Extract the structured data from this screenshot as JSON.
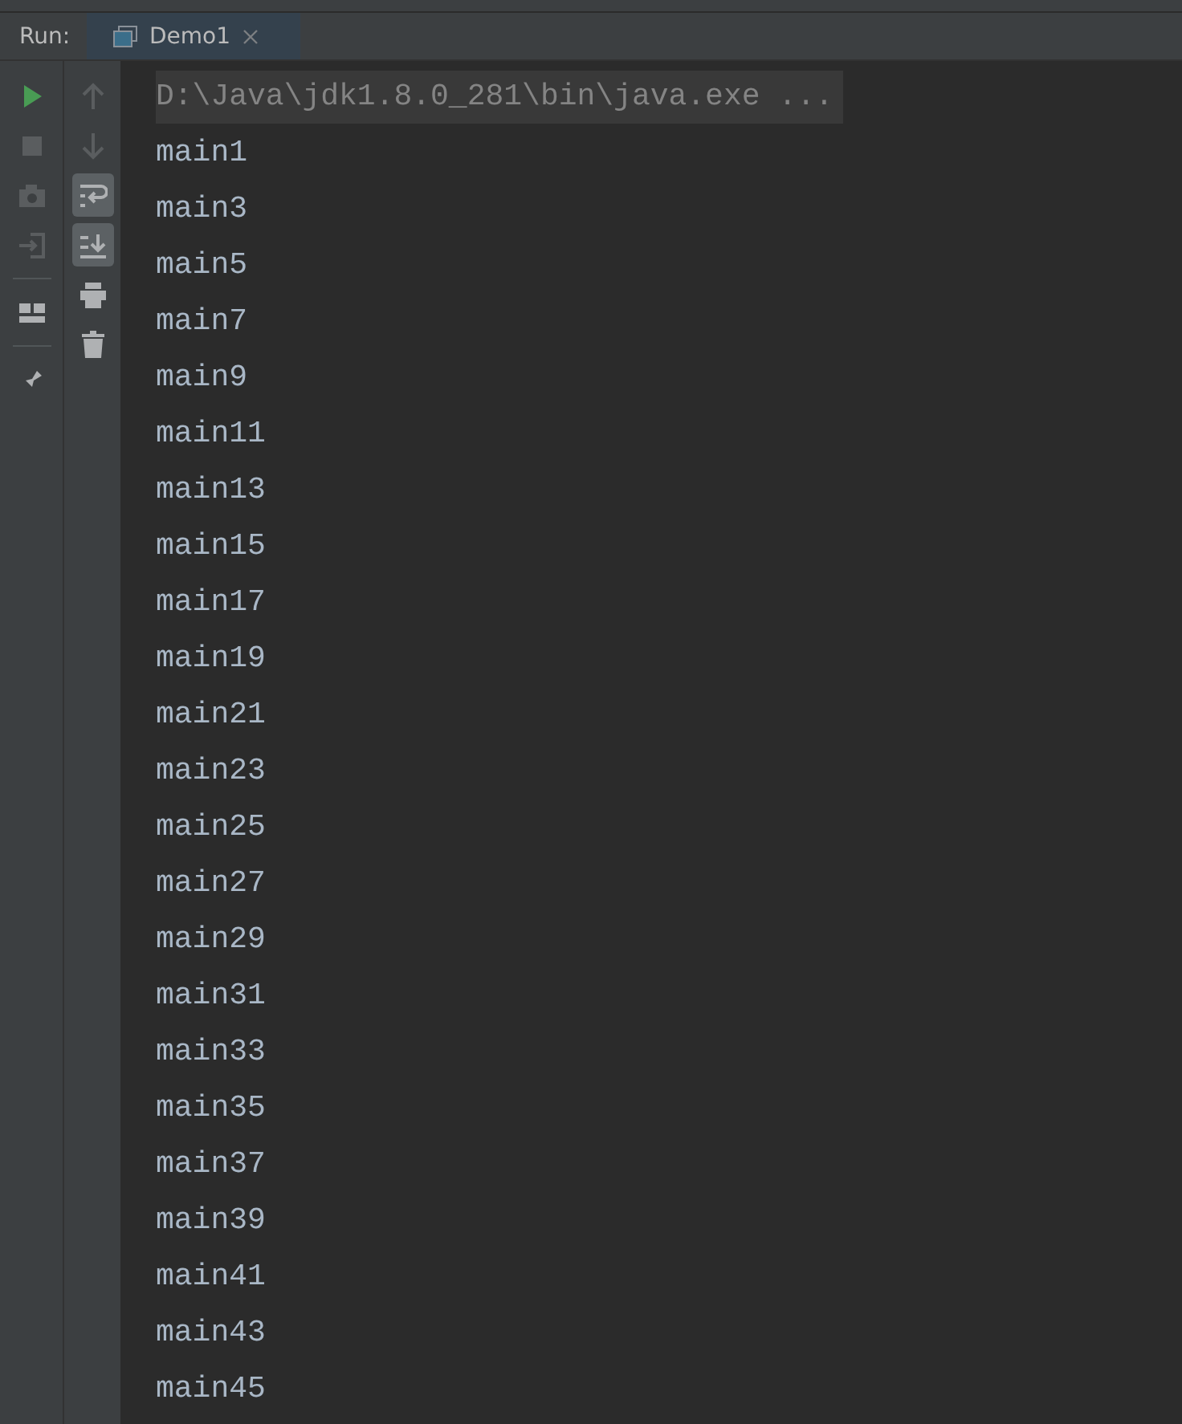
{
  "run_panel": {
    "label": "Run:",
    "tabs": [
      {
        "label": "Demo1",
        "selected": true
      }
    ]
  },
  "left_toolbar": [
    {
      "kind": "run",
      "disabled": false
    },
    {
      "kind": "stop",
      "disabled": true
    },
    {
      "kind": "camera",
      "disabled": true
    },
    {
      "kind": "login",
      "disabled": true
    },
    {
      "kind": "separator"
    },
    {
      "kind": "layout",
      "disabled": false
    },
    {
      "kind": "separator"
    },
    {
      "kind": "pin",
      "disabled": false
    }
  ],
  "right_toolbar": [
    {
      "kind": "up",
      "disabled": true,
      "selected": false
    },
    {
      "kind": "down",
      "disabled": true,
      "selected": false
    },
    {
      "kind": "wrap",
      "disabled": false,
      "selected": true
    },
    {
      "kind": "scroll-end",
      "disabled": false,
      "selected": true
    },
    {
      "kind": "print",
      "disabled": false,
      "selected": false
    },
    {
      "kind": "trash",
      "disabled": false,
      "selected": false
    }
  ],
  "console": {
    "command": "D:\\Java\\jdk1.8.0_281\\bin\\java.exe ...",
    "lines": [
      "main1",
      "main3",
      "main5",
      "main7",
      "main9",
      "main11",
      "main13",
      "main15",
      "main17",
      "main19",
      "main21",
      "main23",
      "main25",
      "main27",
      "main29",
      "main31",
      "main33",
      "main35",
      "main37",
      "main39",
      "main41",
      "main43",
      "main45"
    ]
  }
}
